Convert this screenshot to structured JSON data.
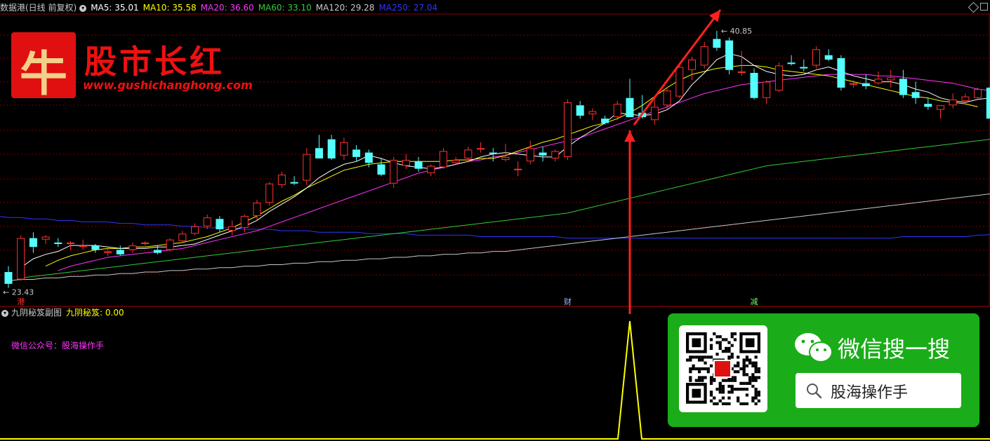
{
  "header": {
    "symbol": "数据港(日线 前复权)",
    "ma_labels": [
      {
        "text": "MA5: 35.01",
        "color": "#ffffff"
      },
      {
        "text": "MA10: 35.58",
        "color": "#ffff00"
      },
      {
        "text": "MA20: 36.60",
        "color": "#ff33ff"
      },
      {
        "text": "MA60: 33.10",
        "color": "#33cc33"
      },
      {
        "text": "MA120: 29.28",
        "color": "#c8c8c8"
      },
      {
        "text": "MA250: 27.04",
        "color": "#3333ff"
      }
    ]
  },
  "brand": {
    "logo_char": "牛",
    "name": "股市长红",
    "url": "www.gushichanghong.com"
  },
  "subchart": {
    "title": "九阴秘笈副图",
    "indicator_label": "九阴秘笈: 0.00",
    "wechat_text": "微信公众号：股海操作手"
  },
  "wechat_card": {
    "title": "微信搜一搜",
    "search_text": "股海操作手"
  },
  "colors": {
    "up": "#ff3232",
    "down": "#54ffff",
    "ma5": "#ffffff",
    "ma10": "#ffff00",
    "ma20": "#ff33ff",
    "ma60": "#33cc33",
    "ma120": "#c8c8c8",
    "ma250": "#3333ff",
    "indicator": "#ffff00",
    "grid": "#7a0000",
    "arrow": "#ff2020"
  },
  "chart_data": {
    "type": "candlestick",
    "price_range": [
      22.6,
      41.8
    ],
    "annotations": {
      "high_label": "40.85",
      "low_label": "23.43"
    },
    "event_markers": [
      {
        "index": 1,
        "label": "港"
      },
      {
        "index": 45,
        "label": "财"
      },
      {
        "index": 60,
        "label": "减"
      }
    ],
    "candles": [
      [
        24.5,
        24.9,
        23.43,
        23.7
      ],
      [
        24.0,
        27.0,
        23.9,
        26.8
      ],
      [
        26.8,
        27.2,
        25.8,
        26.2
      ],
      [
        26.7,
        27.0,
        26.4,
        26.9
      ],
      [
        26.5,
        26.8,
        26.2,
        26.4
      ],
      [
        26.4,
        26.6,
        26.0,
        26.5
      ],
      [
        26.2,
        26.7,
        26.0,
        26.3
      ],
      [
        26.3,
        26.4,
        25.8,
        26.0
      ],
      [
        25.8,
        26.2,
        25.6,
        25.9
      ],
      [
        26.0,
        26.3,
        25.6,
        25.7
      ],
      [
        26.0,
        26.5,
        25.8,
        26.3
      ],
      [
        26.4,
        26.6,
        26.3,
        26.5
      ],
      [
        26.0,
        26.3,
        25.7,
        25.8
      ],
      [
        26.0,
        26.8,
        25.9,
        26.7
      ],
      [
        26.6,
        27.3,
        26.5,
        27.1
      ],
      [
        27.1,
        27.8,
        27.0,
        27.6
      ],
      [
        27.6,
        28.4,
        27.4,
        28.2
      ],
      [
        28.1,
        28.3,
        27.2,
        27.4
      ],
      [
        27.3,
        28.0,
        27.0,
        27.6
      ],
      [
        27.5,
        28.4,
        27.2,
        28.3
      ],
      [
        28.3,
        29.4,
        28.0,
        29.2
      ],
      [
        29.2,
        30.6,
        29.0,
        30.5
      ],
      [
        30.4,
        31.3,
        30.2,
        31.1
      ],
      [
        30.6,
        31.0,
        30.4,
        30.5
      ],
      [
        30.7,
        32.9,
        30.4,
        32.5
      ],
      [
        32.9,
        33.8,
        32.2,
        32.2
      ],
      [
        33.5,
        33.8,
        32.1,
        32.2
      ],
      [
        32.4,
        33.6,
        32.1,
        33.3
      ],
      [
        32.8,
        33.1,
        32.0,
        32.3
      ],
      [
        32.6,
        32.8,
        31.6,
        31.9
      ],
      [
        31.8,
        32.2,
        31.0,
        31.1
      ],
      [
        30.5,
        32.3,
        30.2,
        32.1
      ],
      [
        31.7,
        32.5,
        31.5,
        32.1
      ],
      [
        32.0,
        32.3,
        31.3,
        31.5
      ],
      [
        31.2,
        31.8,
        31.0,
        31.7
      ],
      [
        31.6,
        32.9,
        31.5,
        32.7
      ],
      [
        31.9,
        32.3,
        31.8,
        32.1
      ],
      [
        32.2,
        33.0,
        31.9,
        32.8
      ],
      [
        32.8,
        33.3,
        32.6,
        32.9
      ],
      [
        32.6,
        32.9,
        32.0,
        32.5
      ],
      [
        32.1,
        33.2,
        32.0,
        32.3
      ],
      [
        31.5,
        32.0,
        31.0,
        31.5
      ],
      [
        32.0,
        33.4,
        31.8,
        32.9
      ],
      [
        32.6,
        33.0,
        32.0,
        32.4
      ],
      [
        32.2,
        32.8,
        32.0,
        32.7
      ],
      [
        32.3,
        36.2,
        32.1,
        36.0
      ],
      [
        35.8,
        36.1,
        34.9,
        35.1
      ],
      [
        35.2,
        35.6,
        34.8,
        35.4
      ],
      [
        34.9,
        35.1,
        34.5,
        34.6
      ],
      [
        35.0,
        36.1,
        34.8,
        35.9
      ],
      [
        36.3,
        37.6,
        35.0,
        35.0
      ],
      [
        35.3,
        36.5,
        34.9,
        35.0
      ],
      [
        34.8,
        36.2,
        34.5,
        35.7
      ],
      [
        35.8,
        37.0,
        35.5,
        36.8
      ],
      [
        36.4,
        38.6,
        36.3,
        38.4
      ],
      [
        38.2,
        39.1,
        37.5,
        38.9
      ],
      [
        38.5,
        40.1,
        38.3,
        39.8
      ],
      [
        40.3,
        40.85,
        39.5,
        39.7
      ],
      [
        40.2,
        40.4,
        37.9,
        38.2
      ],
      [
        38.0,
        39.5,
        37.8,
        38.1
      ],
      [
        38.0,
        38.3,
        36.2,
        36.3
      ],
      [
        36.3,
        37.5,
        35.9,
        37.4
      ],
      [
        36.8,
        38.7,
        36.7,
        38.5
      ],
      [
        38.7,
        39.2,
        38.5,
        38.6
      ],
      [
        38.4,
        38.9,
        38.1,
        38.3
      ],
      [
        38.5,
        39.8,
        38.3,
        39.6
      ],
      [
        39.2,
        39.6,
        38.8,
        38.9
      ],
      [
        39.0,
        39.2,
        36.8,
        37.0
      ],
      [
        37.2,
        37.5,
        37.0,
        37.3
      ],
      [
        37.3,
        37.9,
        36.9,
        37.1
      ],
      [
        37.3,
        38.1,
        37.2,
        37.6
      ],
      [
        37.5,
        38.2,
        37.0,
        37.7
      ],
      [
        37.6,
        38.2,
        36.3,
        36.5
      ],
      [
        36.7,
        37.4,
        35.9,
        36.3
      ],
      [
        35.9,
        36.3,
        35.5,
        35.7
      ],
      [
        35.5,
        35.8,
        34.9,
        35.8
      ],
      [
        35.8,
        36.6,
        35.6,
        36.2
      ],
      [
        36.1,
        36.6,
        35.9,
        36.4
      ],
      [
        36.3,
        37.0,
        36.2,
        36.9
      ],
      [
        37.0,
        37.1,
        34.9,
        34.9
      ]
    ],
    "moving_averages": {
      "ma5": {
        "start": 1,
        "values": [
          24.8,
          25.4,
          25.7,
          25.9,
          26.3,
          26.3,
          26.3,
          26.2,
          26.1,
          26.1,
          26.1,
          26.2,
          26.2,
          26.3,
          26.4,
          26.7,
          27.0,
          27.3,
          27.6,
          28.0,
          28.6,
          29.1,
          29.6,
          30.2,
          30.9,
          31.4,
          31.8,
          32.0,
          32.4,
          32.2,
          31.9,
          31.7,
          31.6,
          31.5,
          31.6,
          31.8,
          32.0,
          32.3,
          32.5,
          32.6,
          32.5,
          32.4,
          32.3,
          32.3,
          33.0,
          33.6,
          34.1,
          34.6,
          35.3,
          35.2,
          35.1,
          35.2,
          35.5,
          36.1,
          37.2,
          38.0,
          38.9,
          39.3,
          39.1,
          38.5,
          38.1,
          37.9,
          37.8,
          37.9,
          38.2,
          38.4,
          38.1,
          37.8,
          37.6,
          37.4,
          37.4,
          37.2,
          36.9,
          36.7,
          36.3,
          36.1,
          36.0,
          36.2,
          36.3
        ]
      },
      "ma10": {
        "start": 3,
        "values": [
          24.9,
          25.3,
          25.6,
          25.8,
          26.0,
          26.1,
          26.1,
          26.2,
          26.2,
          26.3,
          26.4,
          26.5,
          26.7,
          26.9,
          27.2,
          27.5,
          27.9,
          28.3,
          28.8,
          29.3,
          29.7,
          30.2,
          30.6,
          31.0,
          31.4,
          31.6,
          31.8,
          31.9,
          32.0,
          32.0,
          32.0,
          32.0,
          32.0,
          32.1,
          32.1,
          32.2,
          32.2,
          32.4,
          32.7,
          33.0,
          33.3,
          33.5,
          33.8,
          34.1,
          34.4,
          34.6,
          34.9,
          35.3,
          35.8,
          36.4,
          37.0,
          37.5,
          37.9,
          38.1,
          38.3,
          38.4,
          38.5,
          38.5,
          38.4,
          38.2,
          38.1,
          38.0,
          37.9,
          37.8,
          37.6,
          37.4,
          37.2,
          37.0,
          36.8,
          36.6,
          36.4,
          36.3,
          36.1,
          36.0,
          35.9,
          35.7
        ]
      },
      "ma20": {
        "start": 4,
        "values": [
          24.6,
          24.9,
          25.1,
          25.3,
          25.5,
          25.6,
          25.7,
          25.8,
          25.9,
          26.0,
          26.1,
          26.3,
          26.5,
          26.7,
          26.9,
          27.1,
          27.3,
          27.6,
          27.9,
          28.2,
          28.5,
          28.8,
          29.1,
          29.4,
          29.7,
          30.0,
          30.3,
          30.6,
          30.9,
          31.2,
          31.4,
          31.6,
          31.8,
          32.0,
          32.1,
          32.3,
          32.4,
          32.6,
          32.8,
          33.0,
          33.2,
          33.4,
          33.6,
          33.9,
          34.2,
          34.5,
          34.8,
          35.1,
          35.4,
          35.7,
          36.0,
          36.3,
          36.6,
          36.8,
          37.0,
          37.2,
          37.3,
          37.4,
          37.5,
          37.6,
          37.7,
          37.8,
          37.9,
          37.9,
          37.9,
          37.9,
          37.8,
          37.8,
          37.7,
          37.6,
          37.5,
          37.4,
          37.3,
          37.1,
          36.9,
          36.8
        ]
      },
      "ma60": {
        "start": 1,
        "values": [
          24.1,
          24.2,
          24.3,
          24.4,
          24.5,
          24.6,
          24.7,
          24.8,
          24.9,
          25.0,
          25.1,
          25.2,
          25.3,
          25.4,
          25.5,
          25.6,
          25.7,
          25.8,
          25.9,
          26.0,
          26.1,
          26.2,
          26.3,
          26.4,
          26.5,
          26.6,
          26.7,
          26.8,
          26.9,
          27.0,
          27.1,
          27.2,
          27.3,
          27.4,
          27.5,
          27.6,
          27.7,
          27.8,
          27.9,
          28.0,
          28.1,
          28.2,
          28.3,
          28.4,
          28.5,
          28.7,
          28.9,
          29.1,
          29.3,
          29.5,
          29.7,
          29.9,
          30.1,
          30.3,
          30.5,
          30.7,
          30.9,
          31.1,
          31.3,
          31.5,
          31.7,
          31.8,
          31.9,
          32.0,
          32.1,
          32.2,
          32.3,
          32.4,
          32.5,
          32.6,
          32.7,
          32.8,
          32.9,
          33.0,
          33.1,
          33.2,
          33.3,
          33.4,
          33.5
        ]
      },
      "ma120": {
        "start": 0,
        "values": [
          23.9,
          24.0,
          24.0,
          24.1,
          24.1,
          24.2,
          24.2,
          24.3,
          24.3,
          24.4,
          24.4,
          24.5,
          24.5,
          24.6,
          24.6,
          24.7,
          24.7,
          24.8,
          24.8,
          24.9,
          24.9,
          25.0,
          25.0,
          25.1,
          25.1,
          25.2,
          25.2,
          25.3,
          25.3,
          25.4,
          25.4,
          25.5,
          25.5,
          25.6,
          25.6,
          25.7,
          25.7,
          25.8,
          25.8,
          25.9,
          25.9,
          26.0,
          26.1,
          26.2,
          26.3,
          26.4,
          26.5,
          26.6,
          26.7,
          26.8,
          26.9,
          27.0,
          27.1,
          27.2,
          27.3,
          27.4,
          27.5,
          27.6,
          27.7,
          27.8,
          27.9,
          28.0,
          28.1,
          28.2,
          28.3,
          28.4,
          28.5,
          28.6,
          28.7,
          28.8,
          28.9,
          29.0,
          29.1,
          29.2,
          29.3,
          29.4,
          29.5,
          29.6,
          29.7,
          29.8
        ]
      },
      "ma250": {
        "start": -1,
        "values": [
          28.3,
          28.2,
          28.2,
          28.1,
          28.1,
          28.0,
          28.0,
          27.9,
          27.9,
          27.9,
          27.8,
          27.8,
          27.7,
          27.7,
          27.7,
          27.6,
          27.6,
          27.5,
          27.5,
          27.5,
          27.4,
          27.4,
          27.4,
          27.3,
          27.3,
          27.3,
          27.2,
          27.2,
          27.2,
          27.2,
          27.1,
          27.1,
          27.1,
          27.1,
          27.0,
          27.0,
          27.0,
          27.0,
          27.0,
          26.9,
          26.9,
          26.9,
          26.9,
          26.9,
          26.9,
          26.9,
          26.8,
          26.8,
          26.8,
          26.8,
          26.8,
          26.8,
          26.8,
          26.8,
          26.8,
          26.8,
          26.8,
          26.8,
          26.8,
          26.8,
          26.8,
          26.8,
          26.8,
          26.8,
          26.8,
          26.8,
          26.8,
          26.8,
          26.8,
          26.8,
          26.8,
          26.8,
          26.8,
          26.9,
          26.9,
          26.9,
          26.9,
          26.9,
          26.9,
          27.0,
          27.04
        ]
      }
    },
    "indicator": {
      "name": "九阴秘笈",
      "range": [
        0,
        1
      ],
      "signal_index": 50,
      "values_note": ""
    }
  }
}
